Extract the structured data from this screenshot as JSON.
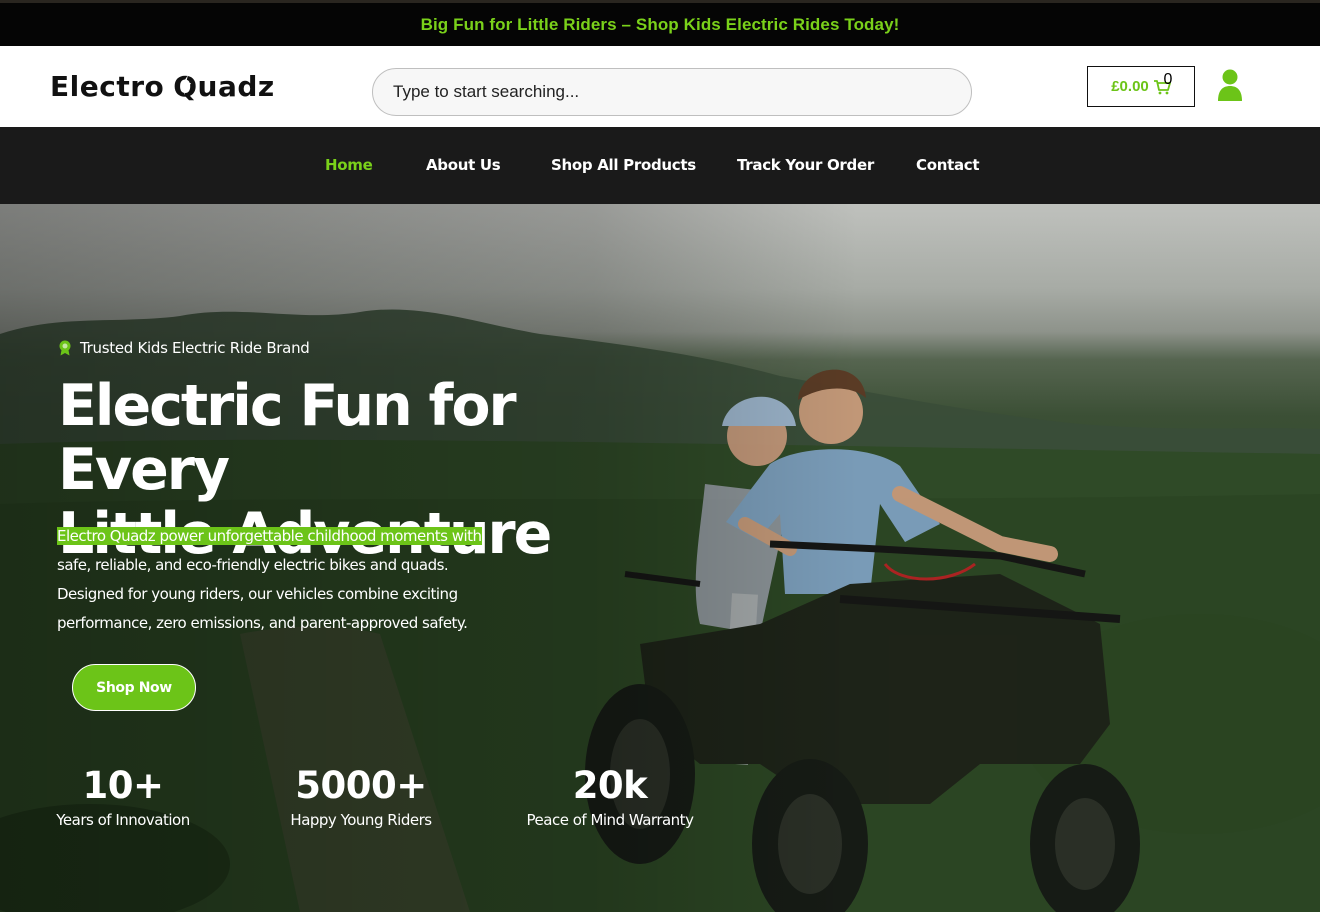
{
  "announcement": {
    "text": "Big Fun for Little Riders – Shop Kids Electric Rides Today!"
  },
  "header": {
    "logo_text_a": "Electro ",
    "logo_text_b": "Quadz",
    "search_placeholder": "Type to start searching...",
    "cart_amount": "£0.00",
    "cart_count": "0",
    "icons": {
      "cart": "cart-icon",
      "user": "user-icon"
    }
  },
  "nav": {
    "items": [
      {
        "label": "Home",
        "active": true
      },
      {
        "label": "About Us",
        "active": false
      },
      {
        "label": "Shop All Products",
        "active": false
      },
      {
        "label": "Track Your Order",
        "active": false
      },
      {
        "label": "Contact",
        "active": false
      }
    ]
  },
  "hero": {
    "badge_icon": "award-icon",
    "badge_text": "Trusted Kids Electric Ride Brand",
    "title_line1": "Electric Fun for Every",
    "title_line2": "Little Adventure",
    "desc_highlight": "Electro Quadz power unforgettable childhood moments with",
    "desc_rest": " safe, reliable, and eco-friendly electric bikes and quads. Designed for young riders, our vehicles combine exciting performance, zero emissions, and parent-approved safety.",
    "cta_label": "Shop Now",
    "stats": [
      {
        "value": "10+",
        "label": "Years of Innovation"
      },
      {
        "value": "5000+",
        "label": "Happy Young Riders"
      },
      {
        "value": "20k",
        "label": "Peace of Mind Warranty"
      }
    ]
  },
  "colors": {
    "accent": "#7ad11a",
    "dark": "#1a1a1a",
    "badge_red": "#d9534f"
  }
}
